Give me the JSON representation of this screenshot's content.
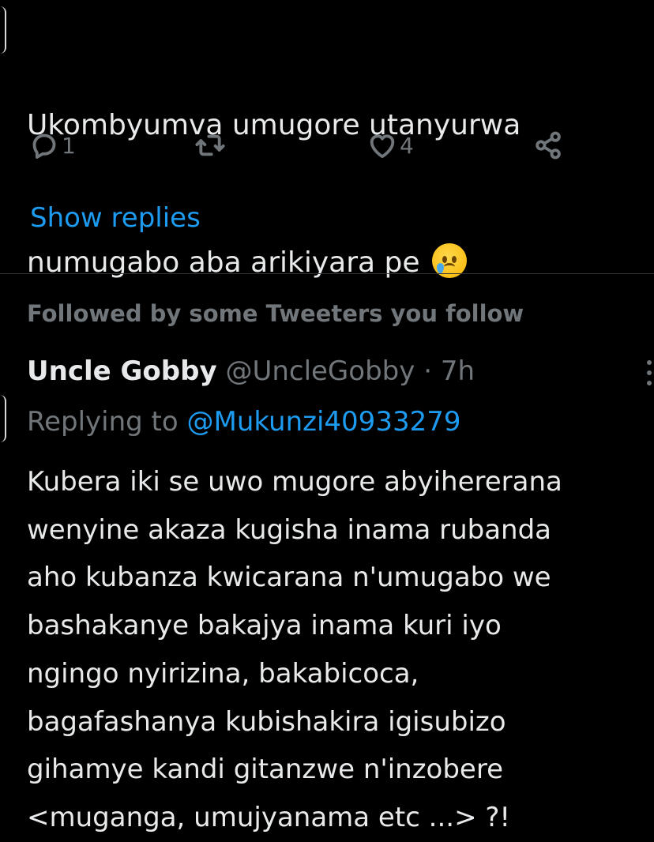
{
  "tweet1": {
    "text_line1": "Ukombyumva umugore utanyurwa",
    "text_line2": "numugabo aba arikiyara pe",
    "emoji": "crying-face",
    "reply_count": "1",
    "retweet_count": "",
    "like_count": "4",
    "show_replies_label": "Show replies"
  },
  "section": {
    "followed_label": "Followed by some Tweeters you follow"
  },
  "tweet2": {
    "author_name": "Uncle Gobby",
    "handle": "@UncleGobby",
    "separator": "·",
    "time": "7h",
    "replying_prefix": "Replying to",
    "replying_mention": "@Mukunzi40933279",
    "body_lines": [
      "Kubera iki se uwo mugore abyihererana",
      "wenyine akaza kugisha inama rubanda",
      "aho kubanza kwicarana n'umugabo we",
      "bashakanye bakajya inama kuri iyo",
      "ngingo nyirizina, bakabicoca,",
      "bagafashanya kubishakira igisubizo",
      "gihamye kandi gitanzwe n'inzobere",
      "<muganga, umujyanama etc ...> ?!"
    ]
  },
  "icons": {
    "reply": "reply-icon",
    "retweet": "retweet-icon",
    "like": "heart-icon",
    "share": "share-icon",
    "more": "more-icon"
  },
  "colors": {
    "background": "#000000",
    "text": "#e7e9ea",
    "muted": "#71767b",
    "accent": "#1d9bf0",
    "divider": "#2f3336"
  }
}
